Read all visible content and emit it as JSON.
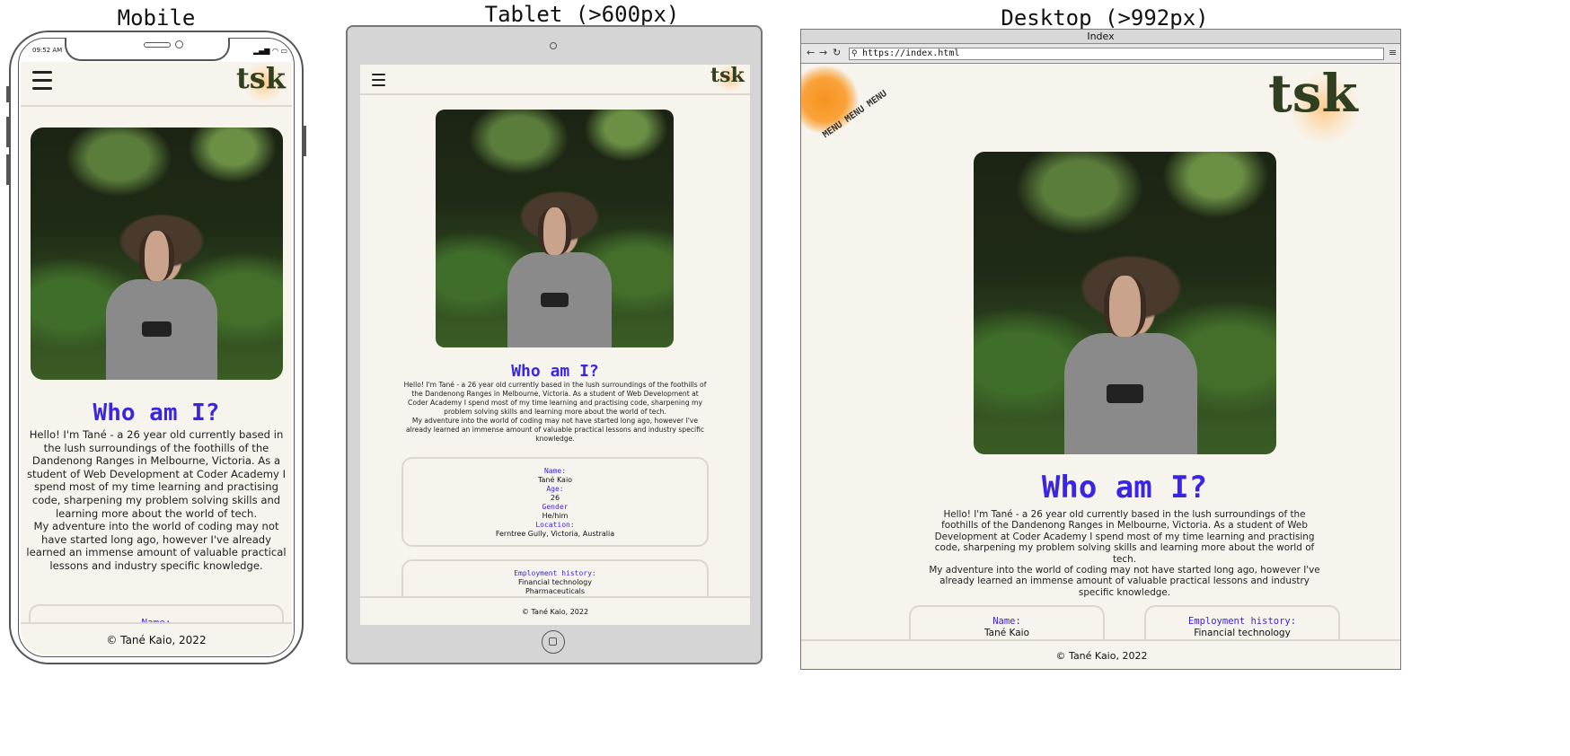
{
  "captions": {
    "mobile": "Mobile",
    "tablet": "Tablet (>600px)",
    "desktop": "Desktop (>992px)"
  },
  "mobile": {
    "status_time": "09:52 AM"
  },
  "browser": {
    "title": "Index",
    "url": "https://index.html"
  },
  "site": {
    "logo": "tsk",
    "sun_text": "MENU MENU MENU",
    "heading": "Who am I?",
    "intro_1": "Hello! I'm Tané - a 26 year old currently based in the lush surroundings of the foothills of the Dandenong Ranges in Melbourne, Victoria. As a student of Web Development at Coder Academy I spend most of my time learning and practising code, sharpening my problem solving skills and learning more about the world of tech.",
    "intro_2": "My adventure into the world of coding may not have started long ago, however I've already learned an immense amount of valuable practical lessons and industry specific knowledge.",
    "info": {
      "name_label": "Name:",
      "name": "Tané Kaio",
      "age_label": "Age:",
      "age": "26",
      "gender_label": "Gender",
      "gender": "He/him",
      "location_label": "Location:",
      "location": "Ferntree Gully, Victoria, Australia"
    },
    "employment": {
      "label": "Employment history:",
      "items": [
        "Financial technology",
        "Pharmaceuticals"
      ]
    },
    "footer": "© Tané Kaio, 2022"
  },
  "colors": {
    "heading": "#3a24e6",
    "page_bg": "#f7f4ee",
    "logo": "#2f3f1f"
  }
}
